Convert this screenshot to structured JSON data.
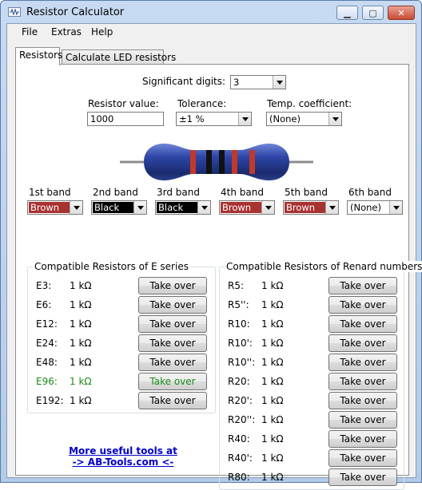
{
  "window": {
    "title": "Resistor Calculator",
    "buttons": {
      "minimize": "▁",
      "maximize": "▢",
      "close": "✕"
    }
  },
  "menu": [
    "File",
    "Extras",
    "Help"
  ],
  "tabs": [
    {
      "label": "Resistors",
      "active": true
    },
    {
      "label": "Calculate LED resistors",
      "active": false
    }
  ],
  "significant_digits": {
    "label": "Significant digits:",
    "value": "3"
  },
  "resistor_value": {
    "label": "Resistor value:",
    "value": "1000"
  },
  "tolerance": {
    "label": "Tolerance:",
    "value": "±1 %"
  },
  "temp_coefficient": {
    "label": "Temp. coefficient:",
    "value": "(None)"
  },
  "bands": [
    {
      "label": "1st band",
      "value": "Brown",
      "color": "#a83232",
      "text_color": "#ffffff"
    },
    {
      "label": "2nd band",
      "value": "Black",
      "color": "#000000",
      "text_color": "#ffffff"
    },
    {
      "label": "3rd band",
      "value": "Black",
      "color": "#000000",
      "text_color": "#ffffff"
    },
    {
      "label": "4th band",
      "value": "Brown",
      "color": "#a83232",
      "text_color": "#ffffff"
    },
    {
      "label": "5th band",
      "value": "Brown",
      "color": "#a83232",
      "text_color": "#ffffff"
    },
    {
      "label": "6th band",
      "value": "(None)",
      "color": "#ffffff",
      "text_color": "#000000"
    }
  ],
  "resistor_image": {
    "body_color": "#2a3e8f",
    "band_colors": [
      "#c0392b",
      "#111111",
      "#111111",
      "#c0392b",
      "#c0392b"
    ]
  },
  "e_series": {
    "title": "Compatible Resistors of E series",
    "rows": [
      {
        "name": "E3:",
        "value": "1 kΩ",
        "button": "Take over",
        "highlight": false
      },
      {
        "name": "E6:",
        "value": "1 kΩ",
        "button": "Take over",
        "highlight": false
      },
      {
        "name": "E12:",
        "value": "1 kΩ",
        "button": "Take over",
        "highlight": false
      },
      {
        "name": "E24:",
        "value": "1 kΩ",
        "button": "Take over",
        "highlight": false
      },
      {
        "name": "E48:",
        "value": "1 kΩ",
        "button": "Take over",
        "highlight": false
      },
      {
        "name": "E96:",
        "value": "1 kΩ",
        "button": "Take over",
        "highlight": true
      },
      {
        "name": "E192:",
        "value": "1 kΩ",
        "button": "Take over",
        "highlight": false
      }
    ]
  },
  "renard": {
    "title": "Compatible Resistors of Renard numbers",
    "rows": [
      {
        "name": "R5:",
        "value": "1 kΩ",
        "button": "Take over"
      },
      {
        "name": "R5'':",
        "value": "1 kΩ",
        "button": "Take over"
      },
      {
        "name": "R10:",
        "value": "1 kΩ",
        "button": "Take over"
      },
      {
        "name": "R10':",
        "value": "1 kΩ",
        "button": "Take over"
      },
      {
        "name": "R10'':",
        "value": "1 kΩ",
        "button": "Take over"
      },
      {
        "name": "R20:",
        "value": "1 kΩ",
        "button": "Take over"
      },
      {
        "name": "R20':",
        "value": "1 kΩ",
        "button": "Take over"
      },
      {
        "name": "R20'':",
        "value": "1 kΩ",
        "button": "Take over"
      },
      {
        "name": "R40:",
        "value": "1 kΩ",
        "button": "Take over"
      },
      {
        "name": "R40':",
        "value": "1 kΩ",
        "button": "Take over"
      },
      {
        "name": "R80:",
        "value": "1 kΩ",
        "button": "Take over"
      }
    ]
  },
  "link": {
    "line1": "More useful tools at",
    "line2": "-> AB-Tools.com <-"
  }
}
